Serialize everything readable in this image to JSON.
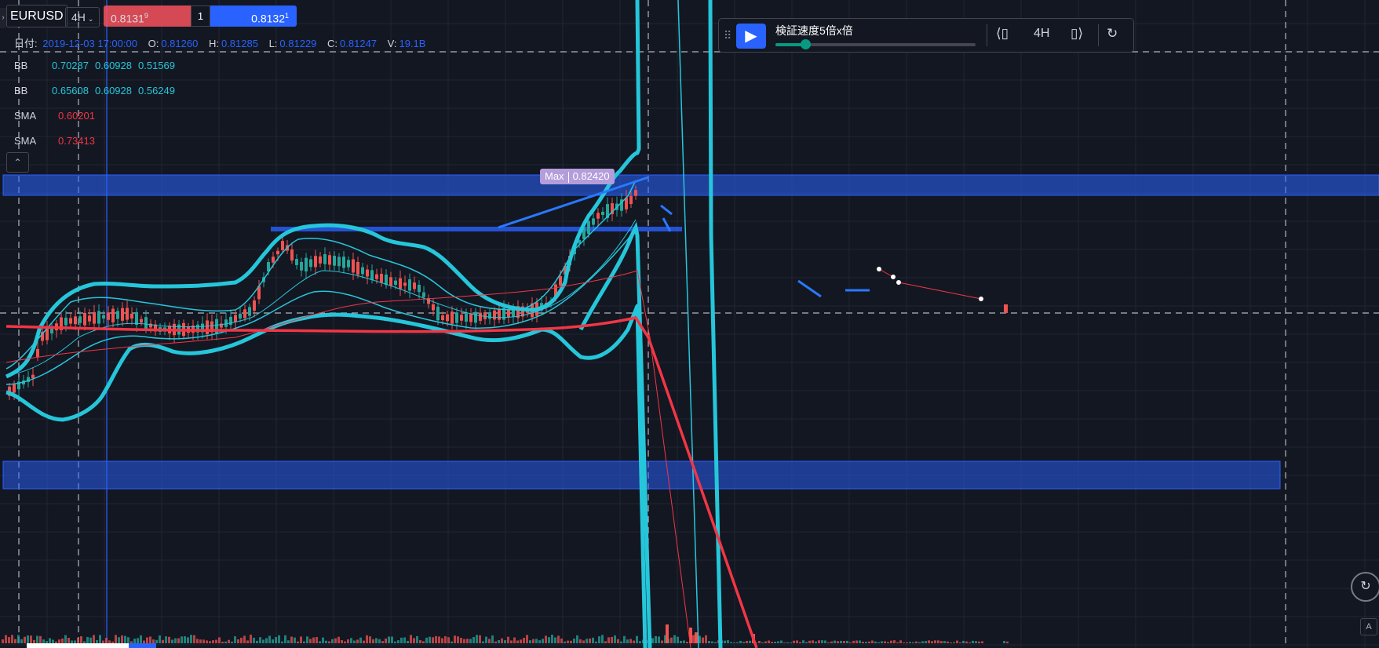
{
  "toolbar": {
    "symbol": "EURUSD",
    "timeframe": "4H",
    "sell_price": "0.8131",
    "sell_price_sup": "9",
    "quantity": "1",
    "buy_price": "0.8132",
    "buy_price_sup": "1"
  },
  "ohlc": {
    "date_label": "日付:",
    "date_value": "2019-12-03 17:00:00",
    "open_label": "O:",
    "open": "0.81260",
    "high_label": "H:",
    "high": "0.81285",
    "low_label": "L:",
    "low": "0.81229",
    "close_label": "C:",
    "close": "0.81247",
    "volume_label": "V:",
    "volume": "19.1B"
  },
  "indicators": [
    {
      "name": "BB",
      "values": [
        "0.70287",
        "0.60928",
        "0.51569"
      ]
    },
    {
      "name": "BB",
      "values": [
        "0.65608",
        "0.60928",
        "0.56249"
      ]
    },
    {
      "name": "SMA",
      "values": [
        "0.60201"
      ]
    },
    {
      "name": "SMA",
      "values": [
        "0.73413"
      ]
    }
  ],
  "max_tag": {
    "label": "Max",
    "value": "0.82420"
  },
  "replay": {
    "speed_label": "検証速度5倍x倍",
    "timeframe": "4H",
    "speed_fraction": 0.15
  },
  "icons": {
    "play": "play-icon",
    "step_back": "step-back-icon",
    "step_forward": "step-forward-icon",
    "jump_to_realtime": "jump-to-realtime-icon",
    "collapse": "chevron-up-icon",
    "auto_scale": "auto-scale-icon"
  },
  "colors": {
    "background": "#131722",
    "bollinger": "#26c6da",
    "sma": "#f23645",
    "zone": "#2962ff",
    "up_candle": "#26a69a",
    "down_candle": "#ef5350"
  }
}
